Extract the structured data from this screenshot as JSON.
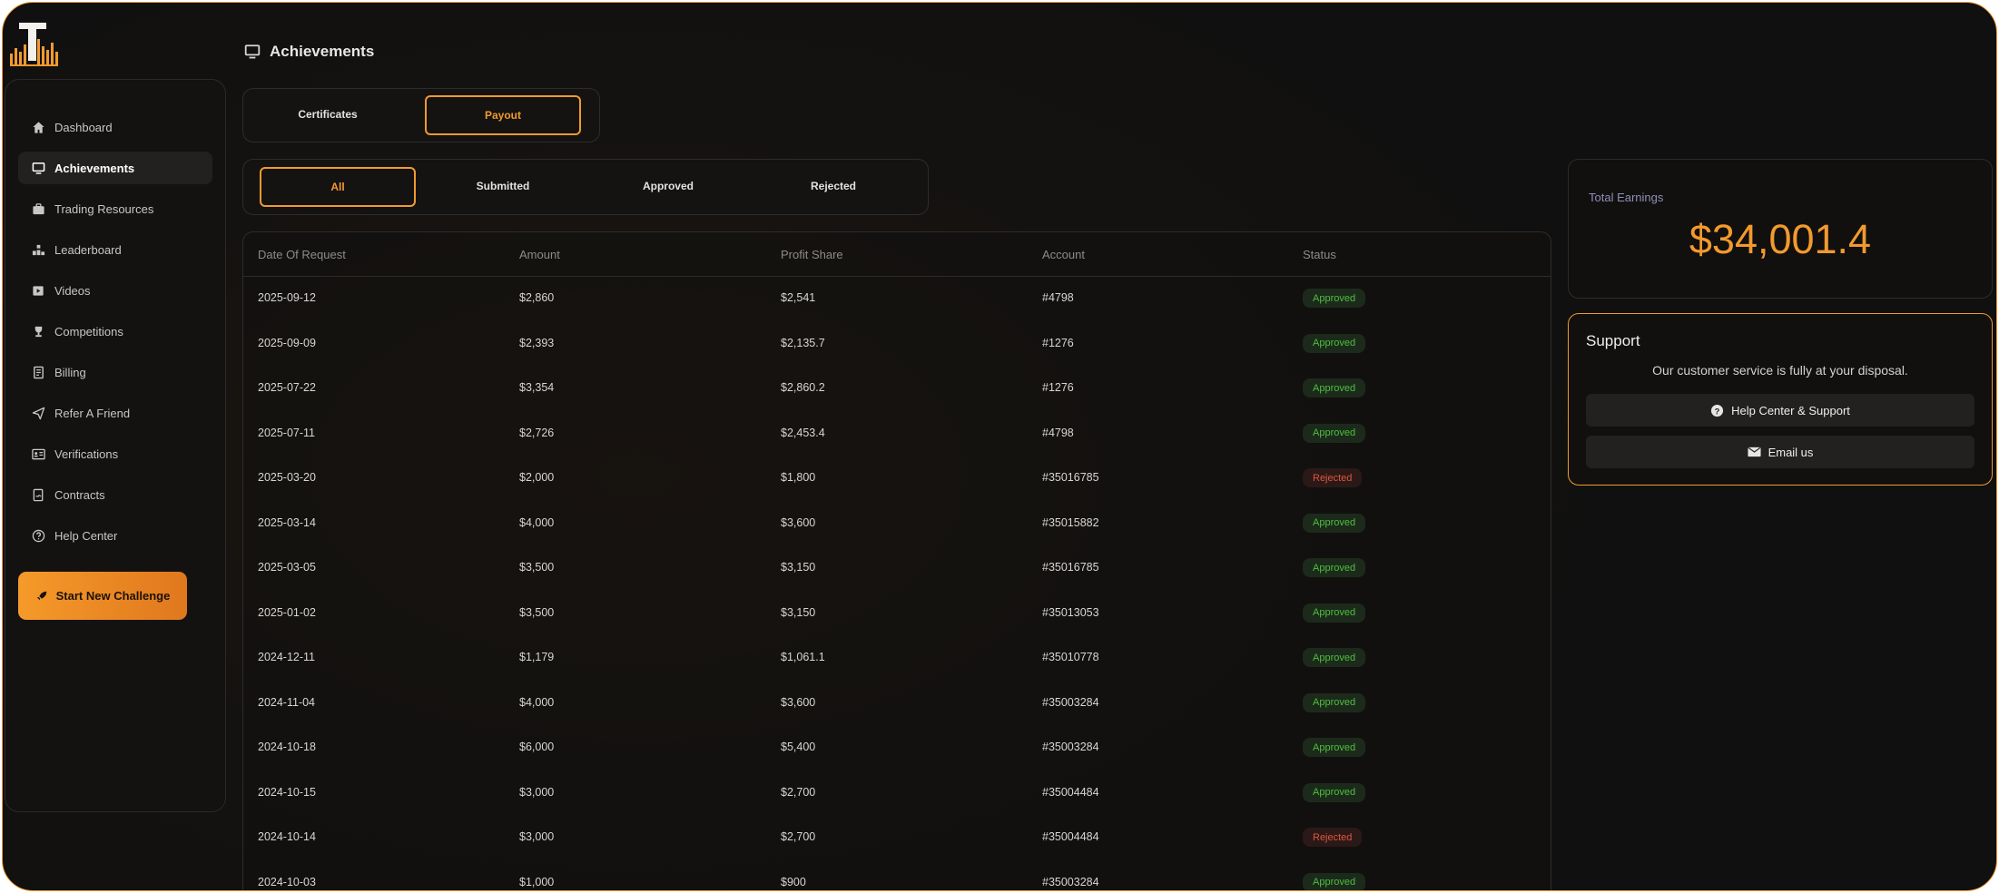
{
  "app": {
    "logo_letter": "T"
  },
  "sidebar": {
    "items": [
      {
        "label": "Dashboard",
        "icon": "home-icon"
      },
      {
        "label": "Achievements",
        "icon": "monitor-icon"
      },
      {
        "label": "Trading Resources",
        "icon": "briefcase-icon"
      },
      {
        "label": "Leaderboard",
        "icon": "leaderboard-icon"
      },
      {
        "label": "Videos",
        "icon": "video-icon"
      },
      {
        "label": "Competitions",
        "icon": "trophy-icon"
      },
      {
        "label": "Billing",
        "icon": "billing-icon"
      },
      {
        "label": "Refer A Friend",
        "icon": "send-icon"
      },
      {
        "label": "Verifications",
        "icon": "id-card-icon"
      },
      {
        "label": "Contracts",
        "icon": "contract-icon"
      },
      {
        "label": "Help Center",
        "icon": "help-icon"
      }
    ],
    "active": "Achievements",
    "cta_label": "Start New Challenge"
  },
  "header": {
    "title": "Achievements"
  },
  "tabs": {
    "certificates": "Certificates",
    "payout": "Payout",
    "selected": "Payout"
  },
  "filters": {
    "all": "All",
    "submitted": "Submitted",
    "approved": "Approved",
    "rejected": "Rejected",
    "selected": "All"
  },
  "table": {
    "columns": [
      "Date Of Request",
      "Amount",
      "Profit Share",
      "Account",
      "Status"
    ],
    "rows": [
      {
        "date": "2025-09-12",
        "amount": "$2,860",
        "profit": "$2,541",
        "account": "#4798",
        "status": "Approved"
      },
      {
        "date": "2025-09-09",
        "amount": "$2,393",
        "profit": "$2,135.7",
        "account": "#1276",
        "status": "Approved"
      },
      {
        "date": "2025-07-22",
        "amount": "$3,354",
        "profit": "$2,860.2",
        "account": "#1276",
        "status": "Approved"
      },
      {
        "date": "2025-07-11",
        "amount": "$2,726",
        "profit": "$2,453.4",
        "account": "#4798",
        "status": "Approved"
      },
      {
        "date": "2025-03-20",
        "amount": "$2,000",
        "profit": "$1,800",
        "account": "#35016785",
        "status": "Rejected"
      },
      {
        "date": "2025-03-14",
        "amount": "$4,000",
        "profit": "$3,600",
        "account": "#35015882",
        "status": "Approved"
      },
      {
        "date": "2025-03-05",
        "amount": "$3,500",
        "profit": "$3,150",
        "account": "#35016785",
        "status": "Approved"
      },
      {
        "date": "2025-01-02",
        "amount": "$3,500",
        "profit": "$3,150",
        "account": "#35013053",
        "status": "Approved"
      },
      {
        "date": "2024-12-11",
        "amount": "$1,179",
        "profit": "$1,061.1",
        "account": "#35010778",
        "status": "Approved"
      },
      {
        "date": "2024-11-04",
        "amount": "$4,000",
        "profit": "$3,600",
        "account": "#35003284",
        "status": "Approved"
      },
      {
        "date": "2024-10-18",
        "amount": "$6,000",
        "profit": "$5,400",
        "account": "#35003284",
        "status": "Approved"
      },
      {
        "date": "2024-10-15",
        "amount": "$3,000",
        "profit": "$2,700",
        "account": "#35004484",
        "status": "Approved"
      },
      {
        "date": "2024-10-14",
        "amount": "$3,000",
        "profit": "$2,700",
        "account": "#35004484",
        "status": "Rejected"
      },
      {
        "date": "2024-10-03",
        "amount": "$1,000",
        "profit": "$900",
        "account": "#35003284",
        "status": "Approved"
      }
    ]
  },
  "earnings": {
    "label": "Total Earnings",
    "value": "$34,001.4"
  },
  "support": {
    "title": "Support",
    "text": "Our customer service is fully at your disposal.",
    "help_label": "Help Center & Support",
    "email_label": "Email us"
  },
  "colors": {
    "accent": "#f29a2e",
    "approved": "#4fbf3e",
    "rejected": "#e0553e"
  }
}
